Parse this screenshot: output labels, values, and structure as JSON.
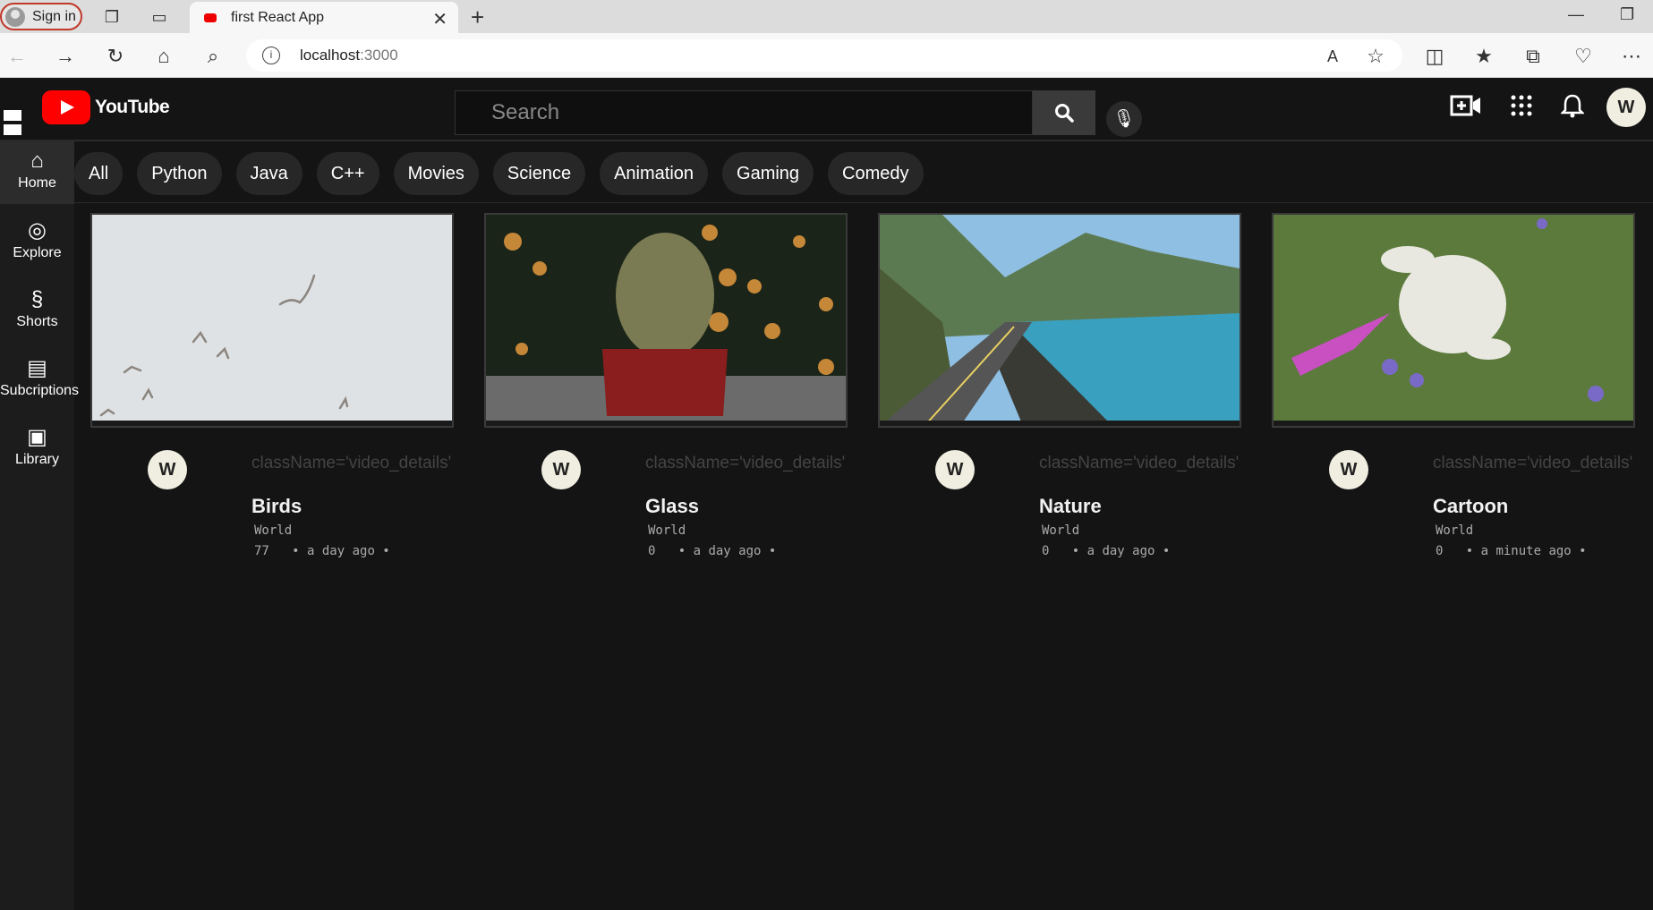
{
  "browser": {
    "signin_label": "Sign in",
    "tab_title": "first React App",
    "url_host": "localhost",
    "url_port": ":3000"
  },
  "app": {
    "logo_text": "YouTube",
    "search_placeholder": "Search",
    "user_initial": "W"
  },
  "sidebar": {
    "items": [
      {
        "label": "Home",
        "icon": "home-icon"
      },
      {
        "label": "Explore",
        "icon": "compass-icon"
      },
      {
        "label": "Shorts",
        "icon": "shorts-icon"
      },
      {
        "label": "Subcriptions",
        "icon": "subscriptions-icon"
      },
      {
        "label": "Library",
        "icon": "library-icon"
      }
    ]
  },
  "chips": [
    "All",
    "Python",
    "Java",
    "C++",
    "Movies",
    "Science",
    "Animation",
    "Gaming",
    "Comedy"
  ],
  "videos": [
    {
      "initial": "W",
      "cls_text": "className='video_details'",
      "title": "Birds",
      "channel": "World",
      "views": "77",
      "time": "a day ago"
    },
    {
      "initial": "W",
      "cls_text": "className='video_details'",
      "title": "Glass",
      "channel": "World",
      "views": "0",
      "time": "a day ago"
    },
    {
      "initial": "W",
      "cls_text": "className='video_details'",
      "title": "Nature",
      "channel": "World",
      "views": "0",
      "time": "a day ago"
    },
    {
      "initial": "W",
      "cls_text": "className='video_details'",
      "title": "Cartoon",
      "channel": "World",
      "views": "0",
      "time": "a minute ago"
    }
  ]
}
